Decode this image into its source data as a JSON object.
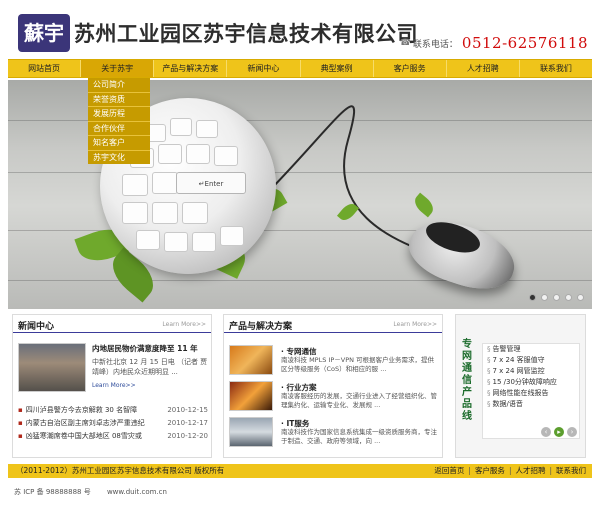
{
  "header": {
    "logo_text": "蘇宇",
    "company_name": "苏州工业园区苏宇信息技术有限公司",
    "phone_label": "联系电话：",
    "phone_number": "0512-62576118"
  },
  "nav": {
    "items": [
      "网站首页",
      "关于苏宇",
      "产品与解决方案",
      "新闻中心",
      "典型案例",
      "客户服务",
      "人才招聘",
      "联系我们"
    ],
    "active_index": 1
  },
  "submenu": {
    "items": [
      "公司简介",
      "荣誉资质",
      "发展历程",
      "合作伙伴",
      "知名客户",
      "苏宇文化"
    ]
  },
  "banner": {
    "key_label": "↵Enter",
    "slide_count": 5,
    "active_slide": 1
  },
  "news": {
    "title": "新闻中心",
    "more": "Learn More>>",
    "featured": {
      "headline": "内地居民物价满意度降至 11 年",
      "desc": "中新社北京 12 月 15 日电 （记者 贾靖峰）内地民众近期明显 ...",
      "more": "Learn More>>"
    },
    "list": [
      {
        "title": "四川泸县警方今去京解救 30 名智障",
        "date": "2010-12-15"
      },
      {
        "title": "内蒙古自治区副主席刘卓志涉严重违纪",
        "date": "2010-12-17"
      },
      {
        "title": "凶猛寒潮席卷中国大部地区 08雪灾或",
        "date": "2010-12-20"
      }
    ]
  },
  "products": {
    "title": "产品与解决方案",
    "more": "Learn More>>",
    "items": [
      {
        "title": "专网通信",
        "desc": "南凌科技 MPLS IP－VPN 可根据客户业务需求，提供区分等级服务（CoS）和相应的服 ..."
      },
      {
        "title": "行业方案",
        "desc": "南凌客服经历的发展，交通行业进入了经营组织化、管理集约化、运输专业化、发展规 ..."
      },
      {
        "title": "IT服务",
        "desc": "南凌科技作为国家信息系统集成一级资质服务商，专注于制造、交通、政府等领域，向 ..."
      }
    ]
  },
  "product_lines": {
    "title": "专网通信产品线",
    "items": [
      "告警管理",
      "7 x 24 客服值守",
      "7 x 24 网管监控",
      "15 /30分钟故障响应",
      "网络性能在线报告",
      "数据/语音"
    ]
  },
  "footer": {
    "copyright": "（2011-2012）苏州工业园区苏宇信息技术有限公司  版权所有",
    "links": [
      "返回首页",
      "客户服务",
      "人才招聘",
      "联系我们"
    ],
    "icp": "苏 ICP 备 98888888 号",
    "site": "www.duit.com.cn"
  }
}
